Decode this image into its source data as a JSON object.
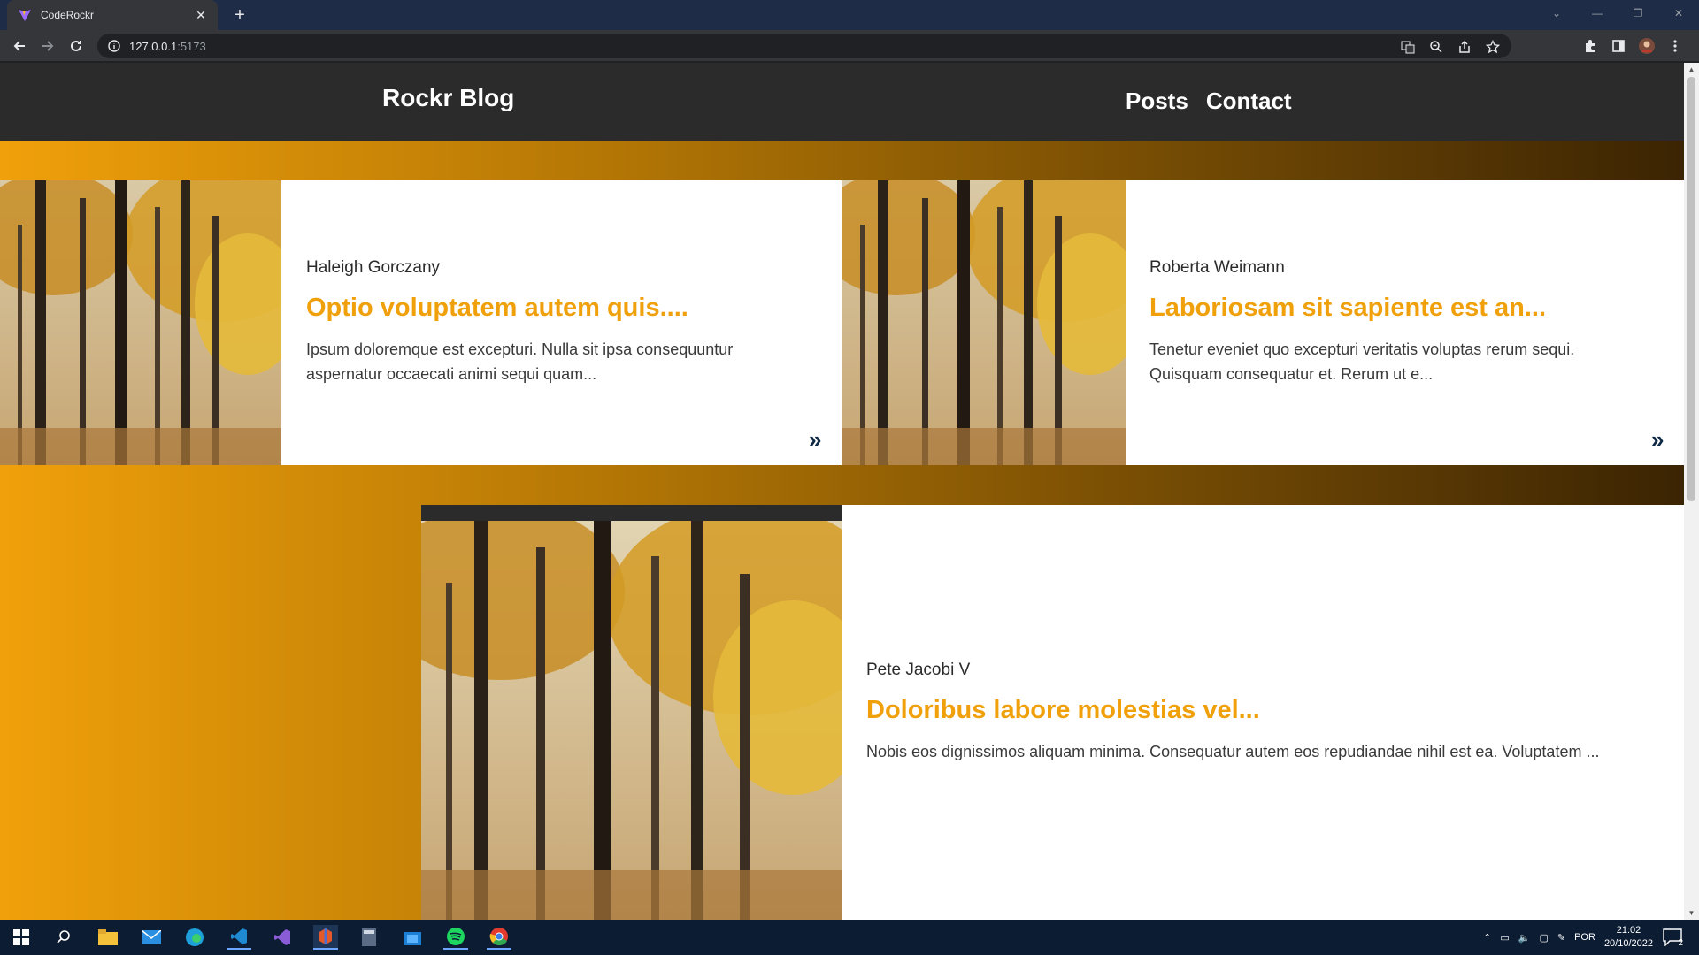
{
  "browser": {
    "tab_title": "CodeRockr",
    "url_host": "127.0.0.1",
    "url_port": ":5173"
  },
  "site": {
    "brand": "Rockr Blog",
    "nav": [
      "Posts",
      "Contact"
    ]
  },
  "posts": [
    {
      "author": "Haleigh Gorczany",
      "title": "Optio voluptatem autem quis....",
      "excerpt": "Ipsum doloremque est excepturi. Nulla sit ipsa consequuntur aspernatur occaecati animi sequi quam..."
    },
    {
      "author": "Roberta Weimann",
      "title": "Laboriosam sit sapiente est an...",
      "excerpt": "Tenetur eveniet quo excepturi veritatis voluptas rerum sequi. Quisquam consequatur et. Rerum ut e..."
    },
    {
      "author": "Pete Jacobi V",
      "title": "Doloribus labore molestias vel...",
      "excerpt": "Nobis eos dignissimos aliquam minima. Consequatur autem eos repudiandae nihil est ea. Voluptatem ..."
    }
  ],
  "taskbar": {
    "lang": "POR",
    "time": "21:02",
    "date": "20/10/2022",
    "notifications": "2"
  },
  "colors": {
    "accent": "#f0a00a",
    "header_bg": "#2b2b2b",
    "gradient_start": "#f0a00a",
    "gradient_end": "#3b2403",
    "arrow": "#102a46"
  }
}
